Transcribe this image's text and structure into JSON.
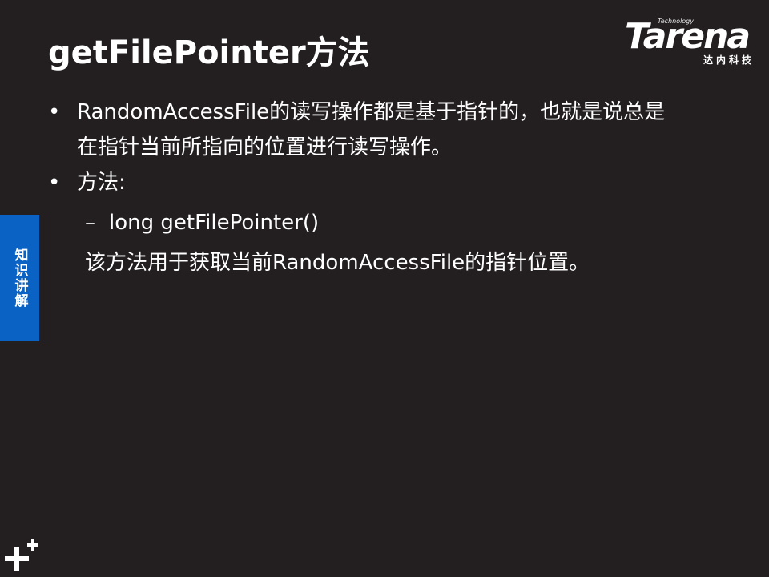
{
  "title": "getFilePointer方法",
  "logo": {
    "technology": "Technology",
    "wordmark": "Tarena",
    "chinese": "达内科技"
  },
  "bullets": [
    {
      "symbol": "•",
      "text": "RandomAccessFile的读写操作都是基于指针的，也就是说总是在指针当前所指向的位置进行读写操作。"
    },
    {
      "symbol": "•",
      "text": "方法:"
    }
  ],
  "sub_item": {
    "dash": "–",
    "text": "long getFilePointer()"
  },
  "description": "该方法用于获取当前RandomAccessFile的指针位置。",
  "side_tab": {
    "label": "知识讲解",
    "color": "#0a63c4"
  },
  "colors": {
    "background": "#231f20",
    "text": "#ffffff"
  },
  "icons": {
    "corner": "plus-decoration-icon"
  }
}
